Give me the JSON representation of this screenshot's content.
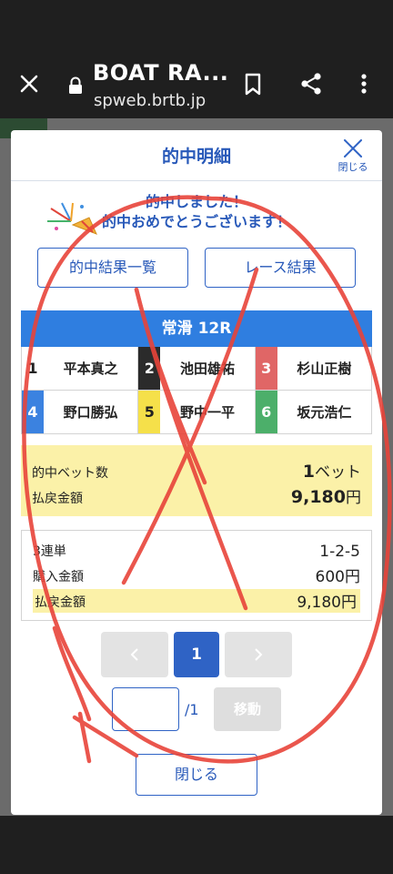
{
  "browser": {
    "title": "BOAT RA...",
    "url": "spweb.brtb.jp"
  },
  "modal": {
    "title": "的中明細",
    "close_icon_label": "閉じる",
    "congrats_line1": "的中しました！",
    "congrats_line2": "的中おめでとうございます！",
    "btn_hit_results": "的中結果一覧",
    "btn_race_results": "レース結果",
    "venue_race": "常滑 12R",
    "racers": [
      {
        "lane": "1",
        "name": "平本真之",
        "lane_bg": "#ffffff",
        "lane_fg": "#222222"
      },
      {
        "lane": "2",
        "name": "池田雄祐",
        "lane_bg": "#2b2b2b",
        "lane_fg": "#ffffff"
      },
      {
        "lane": "3",
        "name": "杉山正樹",
        "lane_bg": "#e06666",
        "lane_fg": "#ffffff"
      },
      {
        "lane": "4",
        "name": "野口勝弘",
        "lane_bg": "#3b82e0",
        "lane_fg": "#ffffff"
      },
      {
        "lane": "5",
        "name": "野中一平",
        "lane_bg": "#f5e04a",
        "lane_fg": "#222222"
      },
      {
        "lane": "6",
        "name": "坂元浩仁",
        "lane_bg": "#4caf6a",
        "lane_fg": "#ffffff"
      }
    ],
    "hit_bets_label": "的中ベット数",
    "hit_bets_num": "1",
    "hit_bets_unit": "ベット",
    "payout_total_label": "払戻金額",
    "payout_total_num": "9,180",
    "payout_total_unit": "円",
    "detail": {
      "bet_type": "3連単",
      "combination": "1-2-5",
      "purchase_label": "購入金額",
      "purchase_value": "600円",
      "payout_label": "払戻金額",
      "payout_value": "9,180円"
    },
    "pagination": {
      "current": "1",
      "total": "/1",
      "move_label": "移動"
    },
    "close_button": "閉じる"
  },
  "colors": {
    "accent": "#2f63c5",
    "header_bar": "#2f7ee0",
    "highlight": "#fbf1a8",
    "annotation": "#e8443a"
  },
  "icons": [
    "close-icon",
    "lock-icon",
    "bookmark-icon",
    "share-icon",
    "more-vert-icon",
    "party-popper-icon",
    "chevron-left-icon",
    "chevron-right-icon"
  ]
}
